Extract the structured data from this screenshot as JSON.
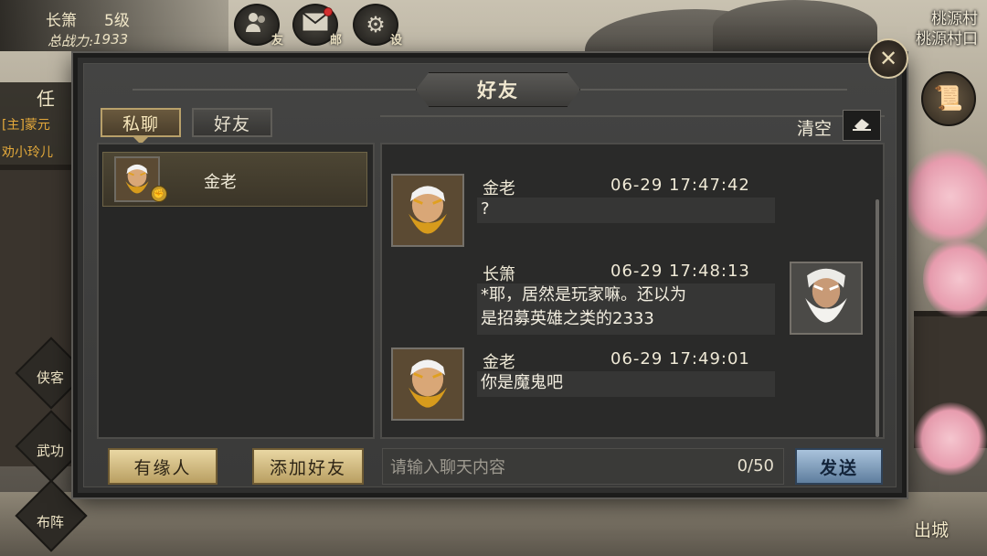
{
  "hud": {
    "player_name": "长箫",
    "level": "5级",
    "power_label": "总战力:",
    "power_value": "1933",
    "buttons": [
      {
        "icon": "friends-icon",
        "label": "友"
      },
      {
        "icon": "mail-icon",
        "label": "邮"
      },
      {
        "icon": "settings-icon",
        "label": "设"
      }
    ],
    "location_area": "桃源村",
    "location_spot": "桃源村口",
    "task_label": "任",
    "quest_1": "[主]蒙元",
    "quest_2": "劝小玲儿",
    "side_menu": [
      "侠客",
      "武功",
      "布阵"
    ],
    "exit_label": "出城"
  },
  "modal": {
    "title": "好友",
    "close_icon": "close-icon",
    "tabs": [
      {
        "label": "私聊",
        "active": true
      },
      {
        "label": "好友",
        "active": false
      }
    ],
    "friends": [
      {
        "name": "金老",
        "avatar": "golden-beard-elder-avatar",
        "badge_icon": "fist-badge-icon"
      }
    ],
    "clear_label": "清空",
    "clear_icon": "eraser-icon",
    "messages": [
      {
        "sender": "金老",
        "time": "06-29 17:47:42",
        "text": "?",
        "side": "left",
        "avatar": "golden-beard-elder-avatar"
      },
      {
        "sender": "长箫",
        "time": "06-29 17:48:13",
        "text_lines": [
          "*耶，居然是玩家嘛。还以为",
          "是招募英雄之类的2333"
        ],
        "side": "right",
        "avatar": "white-beard-elder-avatar"
      },
      {
        "sender": "金老",
        "time": "06-29 17:49:01",
        "text": "你是魔鬼吧",
        "side": "left",
        "avatar": "golden-beard-elder-avatar"
      }
    ],
    "bottom": {
      "fate_button": "有缘人",
      "add_friend_button": "添加好友",
      "input_placeholder": "请输入聊天内容",
      "input_count": "0/50",
      "send_button": "发送"
    }
  }
}
